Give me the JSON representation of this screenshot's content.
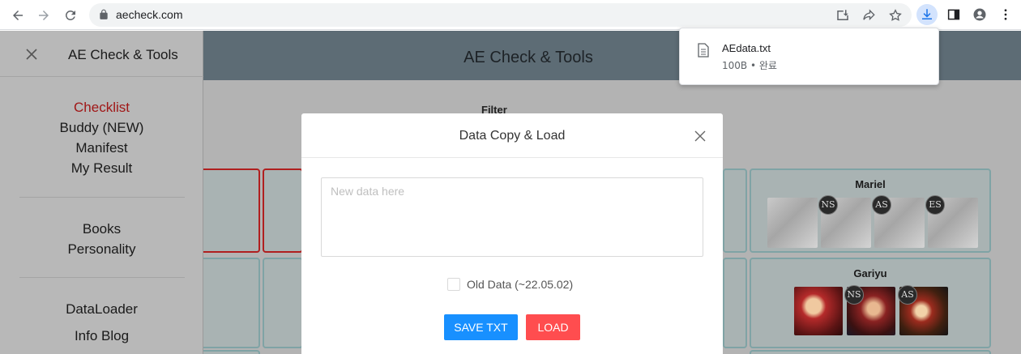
{
  "browser": {
    "url": "aecheck.com"
  },
  "download": {
    "filename": "AEdata.txt",
    "status": "100B • 완료"
  },
  "site": {
    "header_title": "AE Check & Tools",
    "filter_label": "Filter"
  },
  "sidebar": {
    "title": "AE Check & Tools",
    "groups": [
      [
        "Checklist",
        "Buddy (NEW)",
        "Manifest",
        "My Result"
      ],
      [
        "Books",
        "Personality"
      ],
      [
        "DataLoader",
        "Info Blog"
      ]
    ],
    "active_item": "Checklist"
  },
  "cards": {
    "mariel": {
      "name": "Mariel",
      "badges": [
        "NS",
        "AS",
        "ES"
      ]
    },
    "gariyu": {
      "name": "Gariyu",
      "badges": [
        "NS",
        "AS"
      ]
    }
  },
  "modal": {
    "title": "Data Copy & Load",
    "textarea_placeholder": "New data here",
    "textarea_value": "",
    "checkbox_label": "Old Data (~22.05.02)",
    "checkbox_checked": false,
    "save_button": "SAVE TXT",
    "load_button": "LOAD"
  },
  "colors": {
    "save_button": "#1890ff",
    "load_button": "#ff4d4f",
    "active_nav": "#a01717",
    "download_active": "#1a73e8"
  }
}
